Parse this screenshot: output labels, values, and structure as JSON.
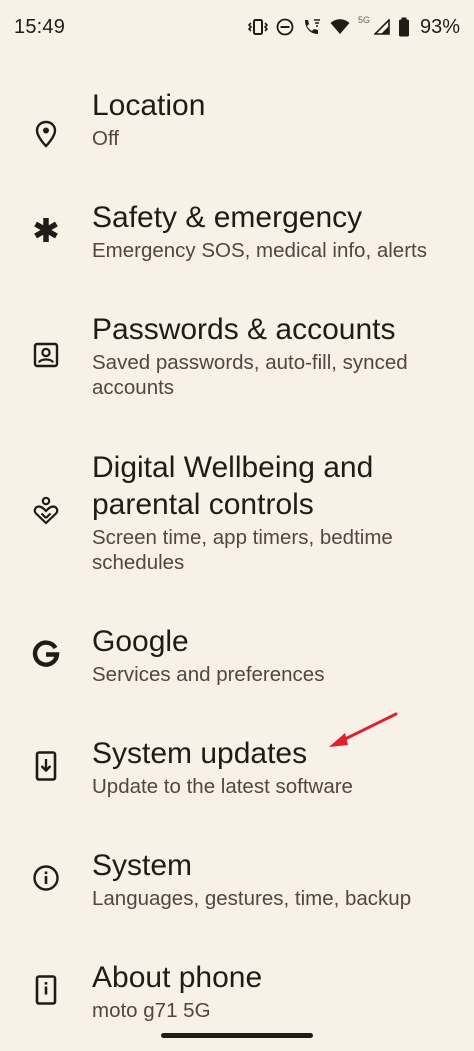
{
  "status": {
    "time": "15:49",
    "network": "5G",
    "battery": "93%"
  },
  "settings": {
    "items": [
      {
        "title": "Location",
        "subtitle": "Off",
        "icon": "location-pin-icon"
      },
      {
        "title": "Safety & emergency",
        "subtitle": "Emergency SOS, medical info, alerts",
        "icon": "asterisk-icon"
      },
      {
        "title": "Passwords & accounts",
        "subtitle": "Saved passwords, auto-fill, synced accounts",
        "icon": "account-box-icon"
      },
      {
        "title": "Digital Wellbeing and parental controls",
        "subtitle": "Screen time, app timers, bedtime schedules",
        "icon": "wellbeing-icon"
      },
      {
        "title": "Google",
        "subtitle": "Services and preferences",
        "icon": "google-g-icon"
      },
      {
        "title": "System updates",
        "subtitle": "Update to the latest software",
        "icon": "system-update-icon"
      },
      {
        "title": "System",
        "subtitle": "Languages, gestures, time, backup",
        "icon": "info-icon"
      },
      {
        "title": "About phone",
        "subtitle": "moto g71 5G",
        "icon": "phone-info-icon"
      }
    ]
  },
  "colors": {
    "background": "#f8f1e8",
    "text": "#1f1b16",
    "subtext": "#504840",
    "annotation_arrow": "#e0202a"
  }
}
